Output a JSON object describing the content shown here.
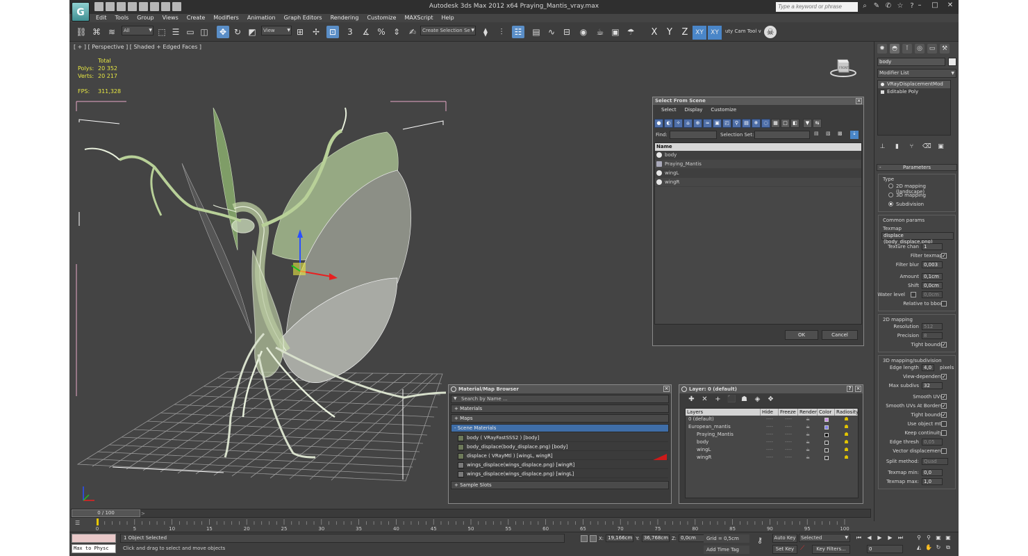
{
  "window": {
    "title": "Autodesk 3ds Max  2012 x64      Praying_Mantis_vray.max",
    "search_placeholder": "Type a keyword or phrase",
    "logo_letter": "G"
  },
  "menu": [
    "Edit",
    "Tools",
    "Group",
    "Views",
    "Create",
    "Modifiers",
    "Animation",
    "Graph Editors",
    "Rendering",
    "Customize",
    "MAXScript",
    "Help"
  ],
  "toolbar": {
    "filter_dropdown": "All",
    "ref_coord_dropdown": "View",
    "selection_set_dropdown": "Create Selection Se",
    "axis_labels": [
      "X",
      "Y",
      "Z",
      "XY",
      "XY"
    ],
    "cam_tool_label": "uty Cam Tool v"
  },
  "viewport": {
    "label": "[ + ] [ Perspective ] [ Shaded + Edged Faces ]",
    "stats_header": "Total",
    "stats": [
      {
        "k": "Polys:",
        "v": "20 352"
      },
      {
        "k": "Verts:",
        "v": "20 217"
      }
    ],
    "fps_label": "FPS:",
    "fps_value": "311,328",
    "viewcube_label": "FRONT"
  },
  "select_from_scene": {
    "title": "Select From Scene",
    "menu": [
      "Select",
      "Display",
      "Customize"
    ],
    "find_label": "Find:",
    "selection_set_label": "Selection Set:",
    "column": "Name",
    "items": [
      {
        "name": "body",
        "type": "mesh"
      },
      {
        "name": "Praying_Mantis",
        "type": "group"
      },
      {
        "name": "wingL",
        "type": "mesh"
      },
      {
        "name": "wingR",
        "type": "mesh"
      }
    ],
    "ok": "OK",
    "cancel": "Cancel"
  },
  "material_browser": {
    "title": "Material/Map Browser",
    "search_placeholder": "Search by Name ...",
    "sections": {
      "materials": "+ Materials",
      "maps": "+ Maps",
      "scene_materials": "- Scene Materials",
      "sample_slots": "+ Sample Slots"
    },
    "scene_materials": [
      "body  ( VRayFastSSS2 )  [body]",
      "body_displace(body_displace.png) [body]",
      "displace  ( VRayMtl )  [wingL, wingR]",
      "wings_displace(wings_displace.png) [wingR]",
      "wings_displace(wings_displace.png) [wingL]"
    ]
  },
  "layer_manager": {
    "title": "Layer: 0 (default)",
    "help": "?",
    "columns": [
      "Layers",
      "Hide",
      "Freeze",
      "Render",
      "Color",
      "Radiosity"
    ],
    "rows": [
      {
        "name": "0 (default)",
        "indent": 0,
        "color": "#c890e8",
        "current": "✓"
      },
      {
        "name": "European_mantis",
        "indent": 0,
        "color": "#8080e8",
        "current": ""
      },
      {
        "name": "Praying_Mantis",
        "indent": 2,
        "color": "#111111",
        "current": ""
      },
      {
        "name": "body",
        "indent": 2,
        "color": "#333333",
        "current": ""
      },
      {
        "name": "wingL",
        "indent": 2,
        "color": "#333333",
        "current": ""
      },
      {
        "name": "wingR",
        "indent": 2,
        "color": "#333333",
        "current": ""
      }
    ],
    "dash": "----"
  },
  "command_panel": {
    "object_name": "body",
    "modifier_list": "Modifier List",
    "stack": [
      "VRayDisplacementMod",
      "Editable Poly"
    ],
    "parameters_title": "Parameters",
    "type_label": "Type",
    "type_options": [
      "2D mapping (landscape)",
      "3D mapping",
      "Subdivision"
    ],
    "common_params": "Common params",
    "texmap_label": "Texmap",
    "texmap_value": "displace (body_displace.png)",
    "texture_chan_label": "Texture chan",
    "texture_chan": "1",
    "filter_texmap_label": "Filter texmap",
    "filter_blur_label": "Filter blur",
    "filter_blur": "0,003",
    "amount_label": "Amount",
    "amount": "0,1cm",
    "shift_label": "Shift",
    "shift": "0,0cm",
    "water_level_label": "Water level",
    "water_level": "0,0cm",
    "relative_label": "Relative to bbox",
    "mapping2d_title": "2D mapping",
    "resolution_label": "Resolution",
    "resolution": "512",
    "precision_label": "Precision",
    "precision": "8",
    "tight_bounds_label": "Tight bounds",
    "mapping3d_title": "3D mapping/subdivision",
    "edge_length_label": "Edge length",
    "edge_length": "4,0",
    "pixels_label": "pixels",
    "view_dependent_label": "View-dependent",
    "max_subdivs_label": "Max subdivs",
    "max_subdivs": "32",
    "smooth_uvs_label": "Smooth UVs",
    "smooth_uvs_borders_label": "Smooth UVs At Borders",
    "tight_bounds2_label": "Tight bounds",
    "use_object_mtl_label": "Use object mtl",
    "keep_continuity_label": "Keep continuity",
    "edge_thresh_label": "Edge thresh",
    "edge_thresh": "0,05",
    "vector_displacement_label": "Vector displacement",
    "split_method_label": "Split method:",
    "split_method": "Quad",
    "texmap_min_label": "Texmap min:",
    "texmap_min": "0,0",
    "texmap_max_label": "Texmap max:",
    "texmap_max": "1,0",
    "check": "✓"
  },
  "time": {
    "slider": "0 / 100",
    "ticks": [
      "0",
      "5",
      "10",
      "15",
      "20",
      "25",
      "30",
      "35",
      "40",
      "45",
      "50",
      "55",
      "60",
      "65",
      "70",
      "75",
      "80",
      "85",
      "90",
      "95",
      "100"
    ]
  },
  "status": {
    "listener_cmd": "Max to Physc",
    "line1": "1 Object Selected",
    "line2": "Click and drag to select and move objects",
    "x_label": "X:",
    "x": "19,166cm",
    "y_label": "Y:",
    "y": "36,768cm",
    "z_label": "Z:",
    "z": "0,0cm",
    "grid": "Grid = 0,5cm",
    "add_time_tag": "Add Time Tag",
    "auto_key": "Auto Key",
    "set_key": "Set Key",
    "selected": "Selected",
    "key_filters": "Key Filters...",
    "frame": "0"
  }
}
